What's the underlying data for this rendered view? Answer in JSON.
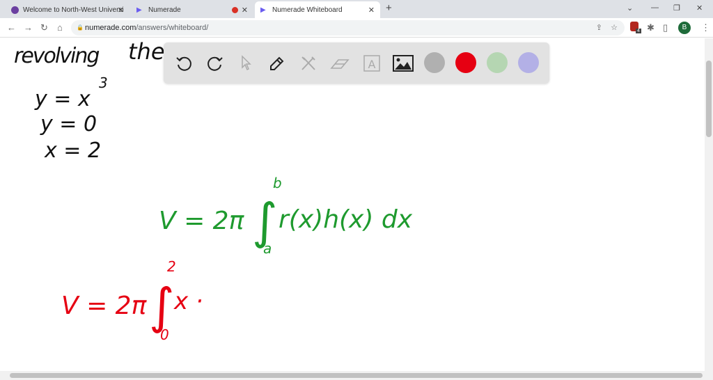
{
  "browser": {
    "tabs": [
      {
        "label": "Welcome to North-West Universi",
        "icon": "university-icon"
      },
      {
        "label": "Numerade",
        "icon": "numerade-icon",
        "recording": true
      },
      {
        "label": "Numerade Whiteboard",
        "icon": "numerade-icon",
        "active": true
      }
    ],
    "new_tab": "+",
    "url_host": "numerade.com",
    "url_path": "/answers/whiteboard/",
    "profile_initial": "B",
    "extension_badge": "4"
  },
  "whiteboard": {
    "tools": [
      "undo-icon",
      "redo-icon",
      "select-icon",
      "pen-icon",
      "shapes-icon",
      "eraser-icon",
      "text-icon",
      "image-icon"
    ],
    "colors": [
      "#b0b0b0",
      "#e60012",
      "#b5d6b2",
      "#b3b0e6"
    ],
    "notes": {
      "revolving": "revolving",
      "the": "the",
      "eq1": "y = x",
      "eq1_exp": "3",
      "eq2": "y = 0",
      "eq3": "x = 2",
      "formula_lhs": "V = 2π",
      "formula_int": "∫",
      "formula_upper": "b",
      "formula_lower": "a",
      "formula_body": "r(x)h(x) dx",
      "work_lhs": "V = 2π",
      "work_int": "∫",
      "work_upper": "2",
      "work_lower": "0",
      "work_body": "x ·"
    }
  }
}
